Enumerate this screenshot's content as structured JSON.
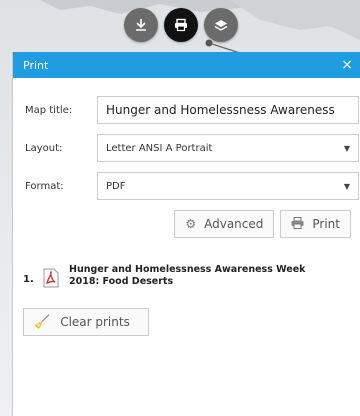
{
  "toolbar": {
    "icons": [
      "mapping-icon",
      "print-icon",
      "layers-icon"
    ],
    "active_index": 1
  },
  "panel": {
    "header_title": "Print",
    "close_glyph": "×",
    "map_title_label": "Map title:",
    "map_title_value": "Hunger and Homelessness Awareness",
    "layout_label": "Layout:",
    "layout_value": "Letter ANSI A Portrait",
    "format_label": "Format:",
    "format_value": "PDF",
    "advanced_label": "Advanced",
    "print_label": "Print",
    "prints": [
      {
        "index": "1.",
        "title": "Hunger and Homelessness Awareness Week 2018: Food Deserts"
      }
    ],
    "clear_prints_label": "Clear prints"
  },
  "colors": {
    "header_blue": "#1f9de0",
    "active_circle": "#111111",
    "inactive_circle": "#6b6b6b",
    "pdf_red": "#d32f2f"
  }
}
